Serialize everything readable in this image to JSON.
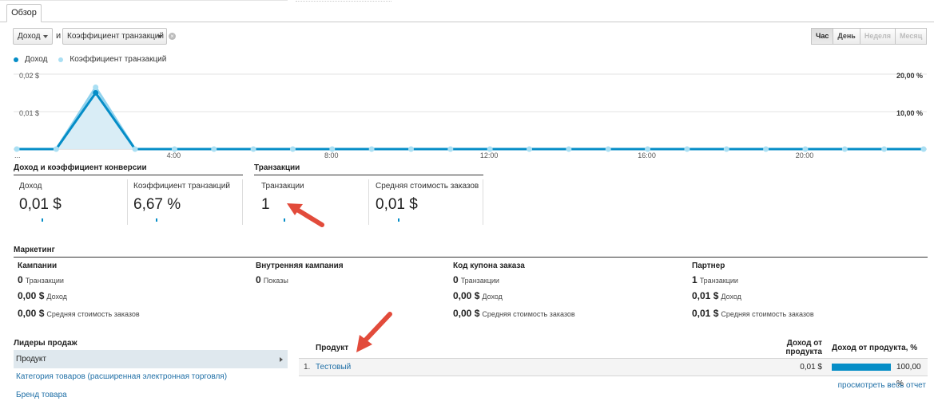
{
  "tab": {
    "label": "Обзор"
  },
  "controls": {
    "metric1": "Доход",
    "connector": "и",
    "metric2": "Коэффициент транзакций",
    "granularity": [
      {
        "label": "Час",
        "state": "active"
      },
      {
        "label": "День",
        "state": "normal"
      },
      {
        "label": "Неделя",
        "state": "disabled"
      },
      {
        "label": "Месяц",
        "state": "disabled"
      }
    ]
  },
  "legend": [
    {
      "label": "Доход",
      "color": "#058dc7"
    },
    {
      "label": "Коэффициент транзакций",
      "color": "#aadff3"
    }
  ],
  "chart_data": {
    "type": "line",
    "x": [
      "0:00",
      "1:00",
      "2:00",
      "3:00",
      "4:00",
      "5:00",
      "6:00",
      "7:00",
      "8:00",
      "9:00",
      "10:00",
      "11:00",
      "12:00",
      "13:00",
      "14:00",
      "15:00",
      "16:00",
      "17:00",
      "18:00",
      "19:00",
      "20:00",
      "21:00",
      "22:00",
      "23:00"
    ],
    "x_tick_labels": [
      "...",
      "4:00",
      "8:00",
      "12:00",
      "16:00",
      "20:00"
    ],
    "series": [
      {
        "name": "Доход",
        "axis": "left",
        "color": "#058dc7",
        "values": [
          0,
          0,
          0.015,
          0,
          0,
          0,
          0,
          0,
          0,
          0,
          0,
          0,
          0,
          0,
          0,
          0,
          0,
          0,
          0,
          0,
          0,
          0,
          0,
          0
        ]
      },
      {
        "name": "Коэффициент транзакций",
        "axis": "right",
        "color": "#8fd2ee",
        "values": [
          0,
          0,
          16.5,
          0,
          0,
          0,
          0,
          0,
          0,
          0,
          0,
          0,
          0,
          0,
          0,
          0,
          0,
          0,
          0,
          0,
          0,
          0,
          0,
          0
        ]
      }
    ],
    "left_axis": {
      "ticks": [
        "0,02 $",
        "0,01 $"
      ],
      "ylim": [
        0,
        0.02
      ]
    },
    "right_axis": {
      "ticks": [
        "20,00 %",
        "10,00 %"
      ],
      "ylim": [
        0,
        20
      ]
    },
    "grid": true
  },
  "kpi_sections": {
    "conversion_title": "Доход и коэффициент конверсии",
    "transactions_title": "Транзакции"
  },
  "kpis": [
    {
      "label": "Доход",
      "value": "0,01 $"
    },
    {
      "label": "Коэффициент транзакций",
      "value": "6,67 %"
    },
    {
      "label": "Транзакции",
      "value": "1"
    },
    {
      "label": "Средняя стоимость заказов",
      "value": "0,01 $"
    }
  ],
  "marketing": {
    "title": "Маркетинг",
    "columns": [
      {
        "header": "Кампании",
        "lines": [
          {
            "value": "0",
            "label": "Транзакции"
          },
          {
            "value": "0,00 $",
            "label": "Доход"
          },
          {
            "value": "0,00 $",
            "label": "Средняя стоимость заказов"
          }
        ]
      },
      {
        "header": "Внутренняя кампания",
        "lines": [
          {
            "value": "0",
            "label": "Показы"
          }
        ]
      },
      {
        "header": "Код купона заказа",
        "lines": [
          {
            "value": "0",
            "label": "Транзакции"
          },
          {
            "value": "0,00 $",
            "label": "Доход"
          },
          {
            "value": "0,00 $",
            "label": "Средняя стоимость заказов"
          }
        ]
      },
      {
        "header": "Партнер",
        "lines": [
          {
            "value": "1",
            "label": "Транзакции"
          },
          {
            "value": "0,01 $",
            "label": "Доход"
          },
          {
            "value": "0,01 $",
            "label": "Средняя стоимость заказов"
          }
        ]
      }
    ]
  },
  "leaders": {
    "title": "Лидеры продаж",
    "items": [
      {
        "label": "Продукт",
        "selected": true
      },
      {
        "label": "Категория товаров (расширенная электронная торговля)",
        "selected": false
      },
      {
        "label": "Бренд товара",
        "selected": false
      }
    ]
  },
  "product_table": {
    "col_product": "Продукт",
    "col_revenue_line1": "Доход от",
    "col_revenue_line2": "продукта",
    "col_share": "Доход от продукта, %",
    "rows": [
      {
        "index": "1.",
        "name": "Тестовый",
        "revenue": "0,01 $",
        "share_value": 100.0,
        "share_text": "100,00 %"
      }
    ],
    "view_all": "просмотреть весь отчет"
  }
}
